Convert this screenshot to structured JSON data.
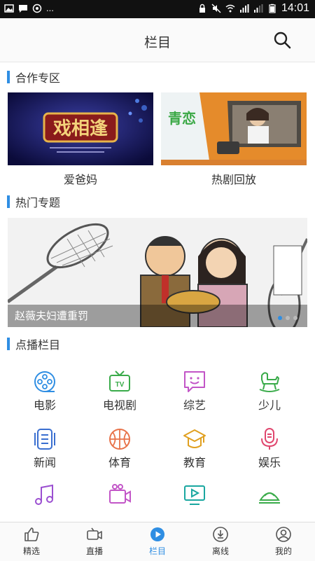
{
  "status": {
    "dots": "...",
    "time": "14:01"
  },
  "header": {
    "title": "栏目"
  },
  "sections": {
    "coop": "合作专区",
    "hot": "热门专题",
    "vod": "点播栏目"
  },
  "coop_cards": [
    {
      "label": "爱爸妈",
      "thumb_text": "戏相逢"
    },
    {
      "label": "热剧回放",
      "thumb_text": "青恋"
    }
  ],
  "banner": {
    "caption": "赵薇夫妇遭重罚",
    "slides": 3,
    "active": 0
  },
  "categories": [
    {
      "label": "电影",
      "icon": "film-reel-icon",
      "color": "#2f8ee3"
    },
    {
      "label": "电视剧",
      "icon": "tv-icon",
      "color": "#3aab4a"
    },
    {
      "label": "综艺",
      "icon": "chat-smile-icon",
      "color": "#c255c7"
    },
    {
      "label": "少儿",
      "icon": "rocking-horse-icon",
      "color": "#3aab4a"
    },
    {
      "label": "新闻",
      "icon": "news-icon",
      "color": "#3a6fd0"
    },
    {
      "label": "体育",
      "icon": "basketball-icon",
      "color": "#e8734a"
    },
    {
      "label": "教育",
      "icon": "graduation-cap-icon",
      "color": "#e0a020"
    },
    {
      "label": "娱乐",
      "icon": "microphone-icon",
      "color": "#e0466e"
    }
  ],
  "tabs": [
    {
      "label": "精选",
      "icon": "thumbs-up-icon"
    },
    {
      "label": "直播",
      "icon": "video-camera-icon"
    },
    {
      "label": "栏目",
      "icon": "play-circle-icon",
      "active": true
    },
    {
      "label": "离线",
      "icon": "download-icon"
    },
    {
      "label": "我的",
      "icon": "user-icon"
    }
  ],
  "colors": {
    "accent": "#2f8ee3",
    "text": "#333333"
  }
}
